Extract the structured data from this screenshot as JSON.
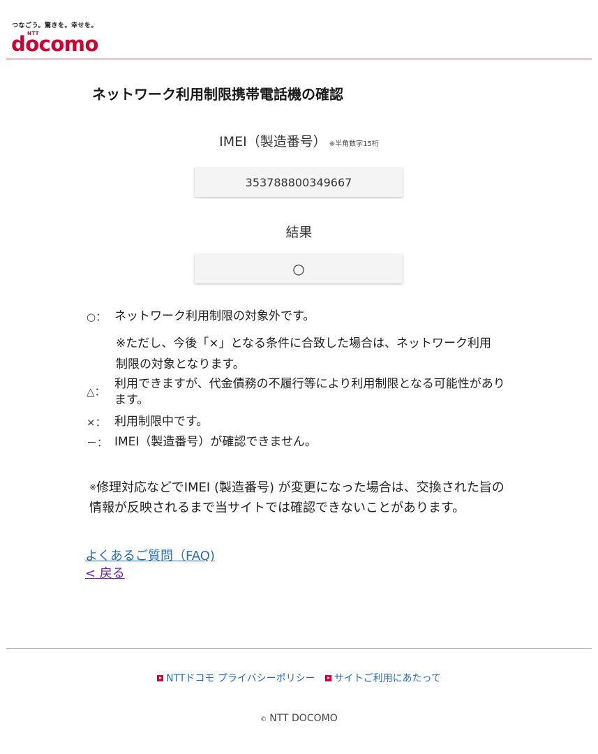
{
  "header": {
    "tagline": "つなごう。驚きを。幸せを。",
    "logo_small": "NTT",
    "logo_word": "docomo"
  },
  "main": {
    "title": "ネットワーク利用制限携帯電話機の確認",
    "imei_label": "IMEI（製造番号）",
    "imei_note": "※半角数字15桁",
    "imei_value": "353788800349667",
    "result_label": "結果",
    "result_value": "○"
  },
  "legend": [
    {
      "symbol": "○：",
      "text": "ネットワーク利用制限の対象外です。"
    },
    {
      "symbol": "",
      "text": "※ただし、今後「×」となる条件に合致した場合は、ネットワーク利用制限の対象となります。"
    },
    {
      "symbol": "△：",
      "text": "利用できますが、代金債務の不履行等により利用制限となる可能性があります。"
    },
    {
      "symbol": "×：",
      "text": "利用制限中です。"
    },
    {
      "symbol": "－：",
      "text": "IMEI（製造番号）が確認できません。"
    }
  ],
  "note": {
    "mark": "※",
    "text": "修理対応などでIMEI (製造番号) が変更になった場合は、交換された旨の情報が反映されるまで当サイトでは確認できないことがあります。"
  },
  "links": {
    "faq": "よくあるご質問（FAQ)",
    "back": "< 戻る"
  },
  "footer": {
    "privacy": "NTTドコモ プライバシーポリシー",
    "site_use": "サイトご利用にあたって",
    "copyright_mark": "©",
    "copyright": "NTT DOCOMO"
  },
  "colors": {
    "brand": "#cc0033",
    "link": "#2a6bb3",
    "visited_link": "#6a22a6"
  }
}
